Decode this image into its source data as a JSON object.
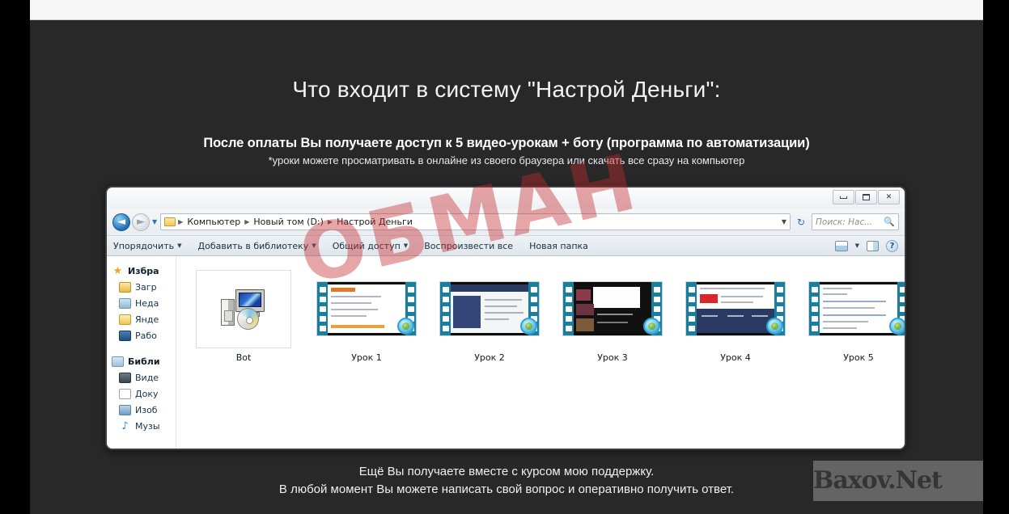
{
  "headline": "Что входит в систему \"Настрой Деньги\":",
  "subhead": "После оплаты Вы получаете доступ к 5 видео-урокам + боту (программа по автоматизации)",
  "subnote": "*уроки можете просматривать в онлайне из своего браузера или скачать все сразу на компьютер",
  "footnote_line1": "Ещё Вы получаете вместе с курсом мою поддержку.",
  "footnote_line2": "В любой момент Вы можете написать свой вопрос и оперативно получить ответ.",
  "explorer": {
    "window_controls": {
      "minimize": "minimize-icon",
      "maximize": "maximize-icon",
      "close": "✕"
    },
    "nav": {
      "back": "◄",
      "forward": "►",
      "history": "▼"
    },
    "address": {
      "folder_icon": "folder-icon",
      "crumbs": [
        "Компьютер",
        "Новый том (D:)",
        "Настрой Деньги"
      ],
      "separator": "▶",
      "dropdown": "▼",
      "refresh": "↻"
    },
    "search": {
      "placeholder": "Поиск: Нас...",
      "icon": "🔍"
    },
    "toolbar": {
      "items": [
        {
          "label": "Упорядочить",
          "caret": "▼"
        },
        {
          "label": "Добавить в библиотеку",
          "caret": "▼"
        },
        {
          "label": "Общий доступ",
          "caret": "▼"
        },
        {
          "label": "Воспроизвести все",
          "caret": ""
        },
        {
          "label": "Новая папка",
          "caret": ""
        }
      ],
      "view_caret": "▼",
      "help_label": "?"
    },
    "sidebar": {
      "groups": [
        {
          "head": {
            "label": "Избра",
            "icon": "star-icon"
          },
          "children": [
            {
              "label": "Загр",
              "icon": "downloads-icon"
            },
            {
              "label": "Неда",
              "icon": "recent-places-icon"
            },
            {
              "label": "Янде",
              "icon": "yandex-disk-icon"
            },
            {
              "label": "Рабо",
              "icon": "desktop-icon"
            }
          ]
        },
        {
          "head": {
            "label": "Библи",
            "icon": "libraries-icon"
          },
          "children": [
            {
              "label": "Виде",
              "icon": "video-icon"
            },
            {
              "label": "Доку",
              "icon": "documents-icon"
            },
            {
              "label": "Изоб",
              "icon": "pictures-icon"
            },
            {
              "label": "Музы",
              "icon": "music-icon"
            }
          ]
        }
      ]
    },
    "items": [
      {
        "label": "Bot",
        "type": "application",
        "selected": true
      },
      {
        "label": "Урок 1",
        "type": "video",
        "selected": false
      },
      {
        "label": "Урок 2",
        "type": "video",
        "selected": false
      },
      {
        "label": "Урок 3",
        "type": "video",
        "selected": false
      },
      {
        "label": "Урок 4",
        "type": "video",
        "selected": false
      },
      {
        "label": "Урок 5",
        "type": "video",
        "selected": false
      }
    ]
  },
  "watermarks": {
    "overlay_text": "ОБМАН",
    "overlay_color": "#c42a30",
    "site_text": "Baxov.Net"
  }
}
